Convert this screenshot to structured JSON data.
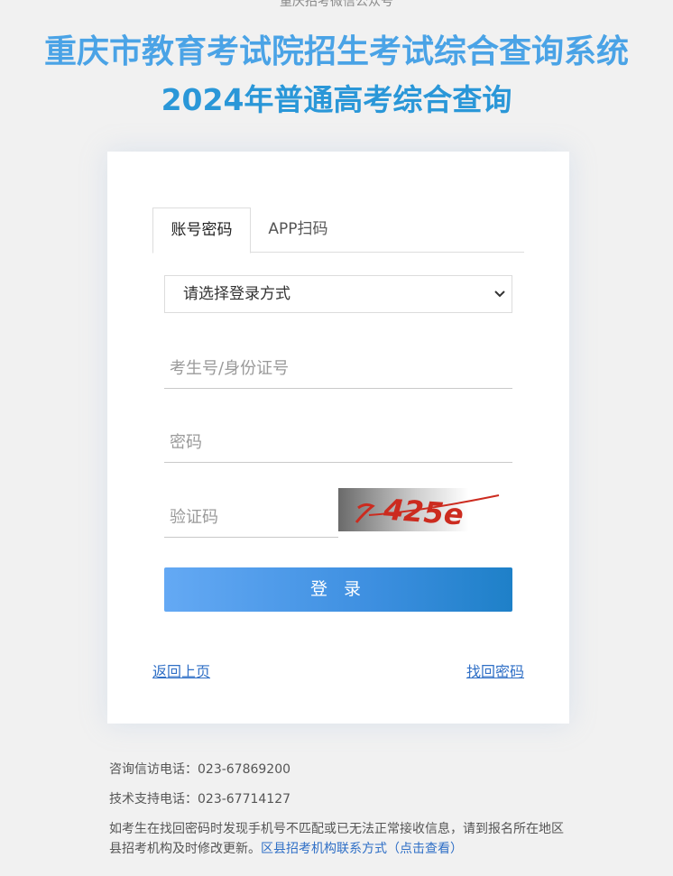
{
  "header": {
    "top_note": "重庆招考微信公众号",
    "title_main": "重庆市教育考试院招生考试综合查询系统",
    "title_sub": "2024年普通高考综合查询"
  },
  "login": {
    "tabs": [
      {
        "label": "账号密码",
        "active": true
      },
      {
        "label": "APP扫码",
        "active": false
      }
    ],
    "method_select": {
      "selected": "请选择登录方式"
    },
    "fields": {
      "id_placeholder": "考生号/身份证号",
      "password_placeholder": "密码",
      "captcha_placeholder": "验证码",
      "captcha_text": "425e"
    },
    "submit_label": "登 录",
    "back_link": "返回上页",
    "forgot_link": "找回密码"
  },
  "footer": {
    "consult_phone": "咨询信访电话：023-67869200",
    "support_phone": "技术支持电话：023-67714127",
    "notice_text": "如考生在找回密码时发现手机号不匹配或已无法正常接收信息，请到报名所在地区县招考机构及时修改更新。",
    "notice_link": "区县招考机构联系方式（点击查看）"
  },
  "colors": {
    "title_main": "#4aa3e6",
    "title_sub": "#2a97d8",
    "button_start": "#64a9f4",
    "button_end": "#1e80c8",
    "link": "#2f6fc6"
  }
}
